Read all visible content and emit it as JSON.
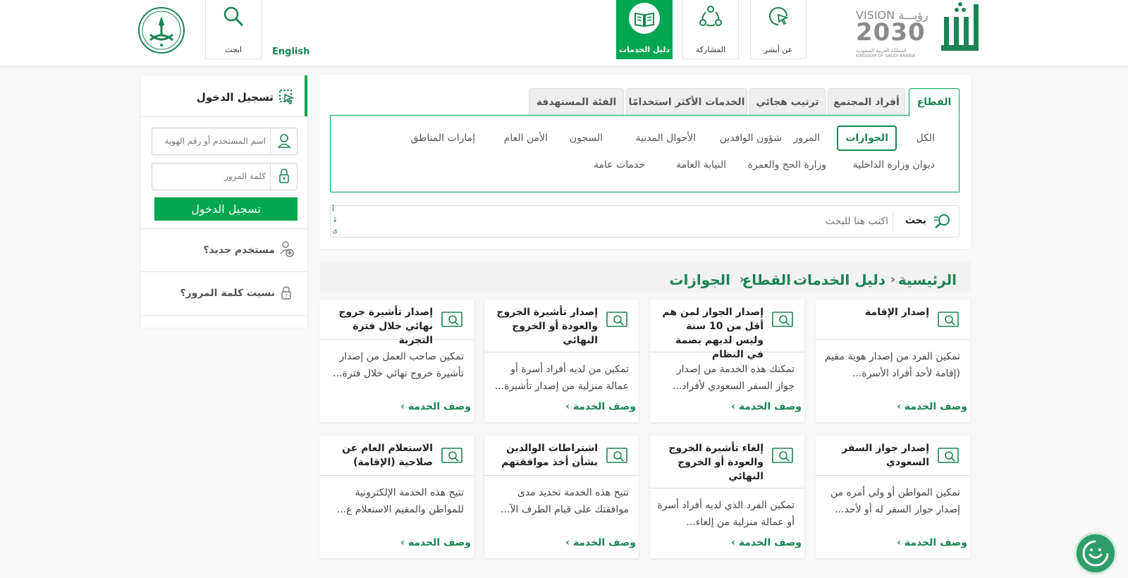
{
  "header": {
    "language_link": "English",
    "search_label": "ابحث",
    "nav": [
      {
        "label": "دليل الخدمات",
        "active": true
      },
      {
        "label": "المشاركة",
        "active": false
      },
      {
        "label": "عن أبشر",
        "active": false
      }
    ],
    "vision": {
      "top": "VISION رؤيـــة",
      "year": "2030",
      "ar": "المملكة العربية السعودية",
      "en": "KINGDOM OF SAUDI ARABIA"
    },
    "brand": "أبشر"
  },
  "tabs": [
    "القطاع",
    "أفراد المجتمع",
    "ترتيب هجائي",
    "الخدمات الأكثر استخدامًا",
    "الفئة المستهدفة"
  ],
  "filters": {
    "row1": [
      "الكل",
      "الجوازات",
      "المرور",
      "شؤون الوافدين",
      "الأحوال المدنية",
      "السجون",
      "الأمن العام",
      "إمارات المناطق"
    ],
    "row2": [
      "ديوان وزارة الداخلية",
      "وزارة الحج والعمرة",
      "النيابة العامة",
      "خدمات عامة"
    ],
    "active": "الجوازات"
  },
  "search": {
    "label": "بحث",
    "placeholder": "اكتب هنا للبحث",
    "sort_glyphs": [
      "أ",
      "↓",
      "ى"
    ]
  },
  "breadcrumb": [
    "الرئيسية",
    "دليل الخدمات",
    "القطاع",
    "الجوازات"
  ],
  "cards": [
    {
      "title": "إصدار الإقامة",
      "desc": "تمكين الفرد من إصدار هوية مقيم (إقامة لأحد أفراد الأسرة...",
      "more": "وصف الخدمة ›"
    },
    {
      "title": "إصدار الجواز لمن هم أقل من 10 سنة وليس لديهم بصمة في النظام",
      "desc": "تمكنك هذه الخدمة من إصدار جواز السفر السعودي لأفراد...",
      "more": "وصف الخدمة ›"
    },
    {
      "title": "إصدار تأشيرة الخروج والعودة أو الخروج النهائي",
      "desc": "تمكين من لديه أفراد أسرة أو عمالة منزلية من إصدار تأشيرة...",
      "more": "وصف الخدمة ›"
    },
    {
      "title": "إصدار تأشيرة خروج نهائي خلال فترة التجربة",
      "desc": "تمكين صاحب العمل من إصدار تأشيرة خروج نهائي خلال فترة...",
      "more": "وصف الخدمة ›"
    },
    {
      "title": "إصدار جواز السفر السعودي",
      "desc": "تمكين المواطن أو ولي أمره من إصدار جواز السفر له أو لأحد...",
      "more": "وصف الخدمة ›"
    },
    {
      "title": "إلغاء تأشيرة الخروج والعودة أو الخروج النهائي",
      "desc": "تمكين الفرد الذي لديه أفراد أسرة أو عمالة منزلية من إلغاء...",
      "more": "وصف الخدمة ›"
    },
    {
      "title": "اشتراطات الوالدين بشأن أخذ موافقتهم",
      "desc": "تتيح هذه الخدمة تحديد مدى موافقتك على قيام الطرف الآ...",
      "more": "وصف الخدمة ›"
    },
    {
      "title": "الاستعلام العام عن صلاحية (الإقامة)",
      "desc": "تتيح هذه الخدمة الإلكترونية للمواطن والمقيم الاستعلام ع...",
      "more": "وصف الخدمة ›"
    }
  ],
  "login": {
    "title": "تسجيل الدخول",
    "username_placeholder": "اسم المستخدم أو رقم الهوية",
    "password_placeholder": "كلمة المرور",
    "button": "تسجيل الدخول",
    "new_user": "مستخدم جديد؟",
    "forgot": "نسيت كلمة المرور؟"
  },
  "colors": {
    "accent": "#00a650",
    "dark_green": "#1b8354",
    "background": "#f7f7f7"
  }
}
